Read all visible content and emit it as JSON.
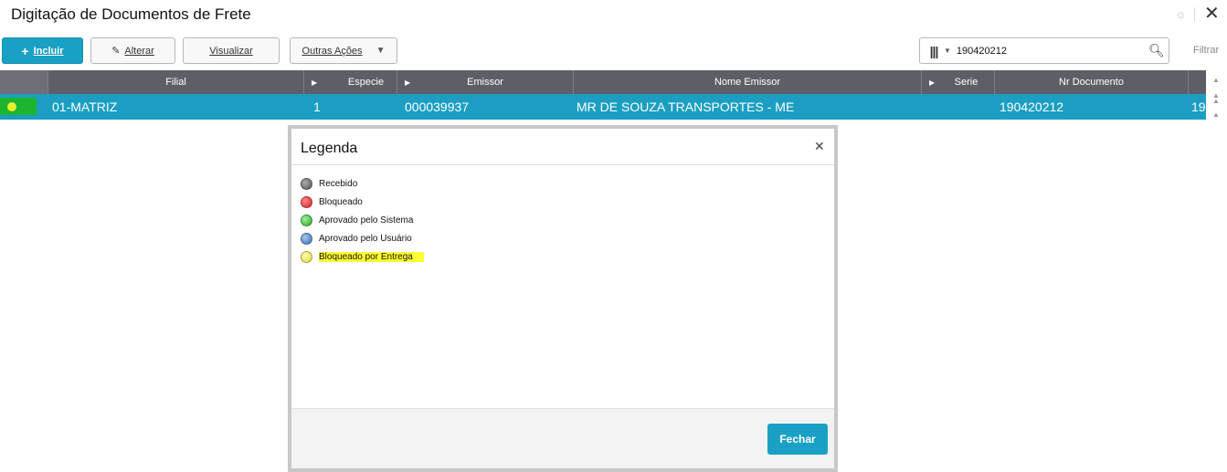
{
  "window": {
    "title": "Digitação de Documentos de Frete"
  },
  "toolbar": {
    "incluir_label": "Incluir",
    "alterar_label": "Alterar",
    "visualizar_label": "Visualizar",
    "outras_label": "Outras Ações"
  },
  "search": {
    "value": "190420212",
    "filtrar_label": "Filtrar"
  },
  "grid": {
    "headers": [
      "Filial",
      "Especie",
      "Emissor",
      "Nome Emissor",
      "Serie",
      "Nr Documento"
    ],
    "row": {
      "status_color": "#e8ef2a",
      "filial": "01-MATRIZ",
      "especie": "1",
      "emissor": "000039937",
      "nome_emissor": "MR DE SOUZA TRANSPORTES - ME",
      "serie": "",
      "nr_documento": "190420212",
      "extra": "19"
    }
  },
  "modal": {
    "title": "Legenda",
    "items": [
      {
        "label": "Recebido",
        "color": "#666666"
      },
      {
        "label": "Bloqueado",
        "color": "#e23a3a"
      },
      {
        "label": "Aprovado pelo Sistema",
        "color": "#45c440"
      },
      {
        "label": "Aprovado pelo Usuário",
        "color": "#4a86c8"
      },
      {
        "label": "Bloqueado por Entrega",
        "color": "#f2ec4a"
      }
    ],
    "close_label": "Fechar"
  },
  "colors": {
    "primary": "#1aa0c5",
    "row_selected": "#1b9ec2",
    "header": "#5c6066"
  }
}
